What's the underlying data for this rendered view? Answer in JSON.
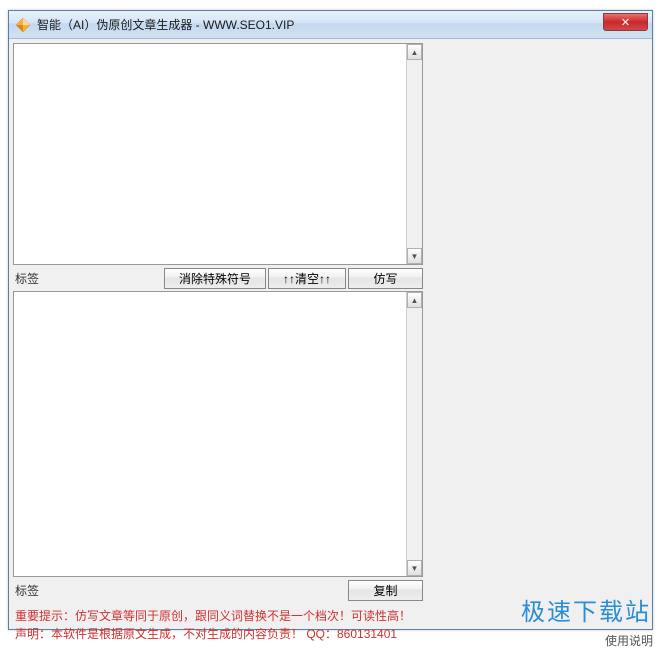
{
  "titlebar": {
    "title": "智能（AI）伪原创文章生成器 - WWW.SEO1.VIP",
    "close_label": "✕"
  },
  "top_section": {
    "label": "标签",
    "buttons": {
      "remove_special": "消除特殊符号",
      "clear": "↑↑清空↑↑",
      "rewrite": "仿写"
    }
  },
  "bottom_section": {
    "label": "标签",
    "buttons": {
      "copy": "复制"
    }
  },
  "notice": {
    "line1": "重要提示：仿写文章等同于原创，跟同义词替换不是一个档次！可读性高！",
    "line2": "声明：本软件是根据原文生成，不对生成的内容负责！   QQ：860131401"
  },
  "watermark": "极速下载站",
  "usage_label": "使用说明"
}
